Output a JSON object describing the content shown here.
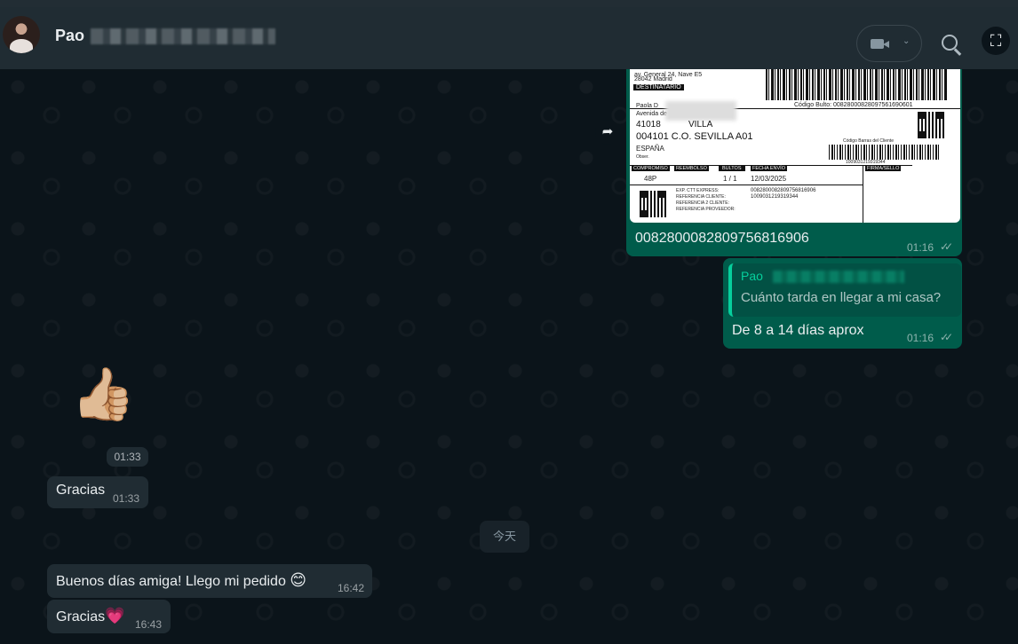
{
  "header": {
    "contact_name_visible": "Pao",
    "video_chevron": "⌄",
    "corner_icon": "⛶"
  },
  "messages": {
    "label": {
      "top_line1": "av. General 24, Nave E5",
      "top_line2": "28042 Madrid",
      "destinatario": "DESTINATARIO",
      "codigo_bulto": "Código Bulto: 00828000828097561690601",
      "recipient_name": "Paola D",
      "recipient_street": "Avenida de",
      "postal_city": "41018",
      "city_partial": "VILLA",
      "center": "004101 C.O. SEVILLA A01",
      "country": "ESPAÑA",
      "obser": "Obser.",
      "codigo_barras_label": "Código Barras del Cliente",
      "barcode_number": "1009031219319344",
      "col_compromiso": "COMPROMISO",
      "col_reembolso": "REEMBOLSO",
      "col_bultos": "BULTOS",
      "col_fecha": "FECHA ENVÍO",
      "col_firma": "FIRMA/SELLO",
      "val_compromiso": "48P",
      "val_bultos": "1 / 1",
      "val_fecha": "12/03/2025",
      "exp_label": "EXP. CTT EXPRESS:",
      "ref_cliente": "REFERENCIA CLIENTE:",
      "ref_cliente2": "REFERENCIA 2 CLIENTE:",
      "ref_proveedor": "REFERENCIA PROVEEDOR:",
      "exp_value": "0082800082809756816906",
      "ref_value": "1009031219319344"
    },
    "tracking_text": "0082800082809756816906",
    "tracking_time": "01:16",
    "quote_name": "Pao",
    "quote_text": "Cuánto tarda en llegar a mi casa?",
    "reply_text": "De 8 a 14 días aprox",
    "reply_time": "01:16",
    "thumbs_emoji": "👍🏼",
    "thumbs_time": "01:33",
    "gracias1_text": "Gracias",
    "gracias1_time": "01:33",
    "day_divider": "今天",
    "buenos_text": "Buenos días amiga! Llego mi pedido",
    "buenos_emoji": "😊",
    "buenos_time": "16:42",
    "gracias2_text": "Gracias",
    "gracias2_emoji": "💗",
    "gracias2_time": "16:43",
    "read_ticks": "✓✓"
  },
  "colors": {
    "background": "#0b141a",
    "header": "#202c33",
    "outgoing": "#005c4b",
    "incoming": "#202c33",
    "quote_accent": "#06cf9c"
  },
  "icons": [
    "video-call-icon",
    "search-icon",
    "lens-icon",
    "forward-icon",
    "read-receipt-icon"
  ]
}
